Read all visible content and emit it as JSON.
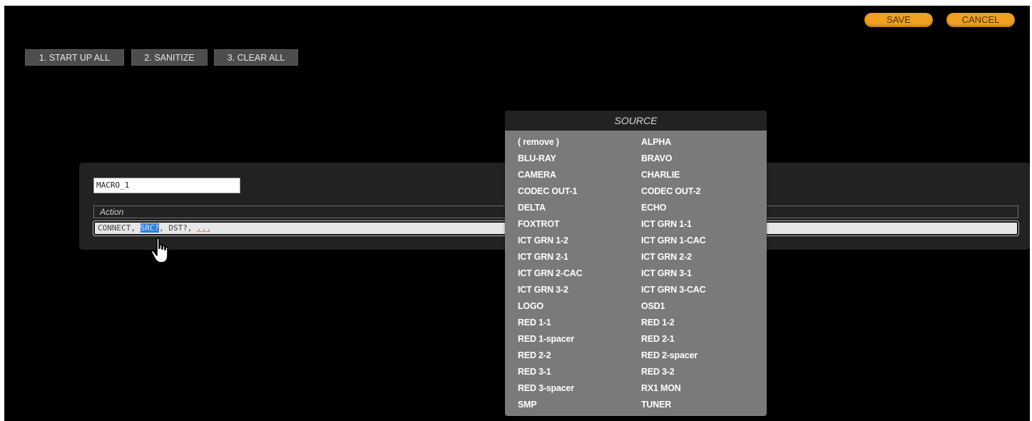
{
  "toolbar": {
    "save_label": "SAVE",
    "cancel_label": "CANCEL"
  },
  "macros": {
    "start_up_all": "1. START UP ALL",
    "sanitize": "2. SANITIZE",
    "clear_all": "3. CLEAR ALL"
  },
  "editor": {
    "macro_name_value": "MACRO_1",
    "action_header": "Action",
    "action_prefix": "CONNECT, ",
    "action_selected": "SRC?",
    "action_middle": ", DST?, ",
    "action_suffix": "..."
  },
  "source_popup": {
    "title": "SOURCE",
    "items": [
      "( remove )",
      "ALPHA",
      "BLU-RAY",
      "BRAVO",
      "CAMERA",
      "CHARLIE",
      "CODEC OUT-1",
      "CODEC OUT-2",
      "DELTA",
      "ECHO",
      "FOXTROT",
      "ICT GRN 1-1",
      "ICT GRN 1-2",
      "ICT GRN 1-CAC",
      "ICT GRN 2-1",
      "ICT GRN 2-2",
      "ICT GRN 2-CAC",
      "ICT GRN 3-1",
      "ICT GRN 3-2",
      "ICT GRN 3-CAC",
      "LOGO",
      "OSD1",
      "RED 1-1",
      "RED 1-2",
      "RED 1-spacer",
      "RED 2-1",
      "RED 2-2",
      "RED 2-spacer",
      "RED 3-1",
      "RED 3-2",
      "RED 3-spacer",
      "RX1 MON",
      "SMP",
      "TUNER"
    ]
  },
  "colors": {
    "background": "#000000",
    "accent_button": "#f0a020",
    "panel": "#222222",
    "popup": "#7a7a7a",
    "selection": "#2f7de0"
  },
  "icons": {
    "cursor": "hand-pointer-icon"
  }
}
